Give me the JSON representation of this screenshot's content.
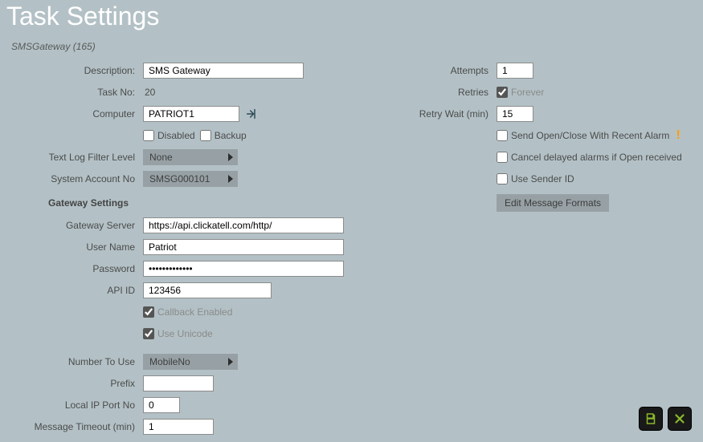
{
  "title": "Task Settings",
  "subtitle": "SMSGateway (165)",
  "left": {
    "description_label": "Description:",
    "description_value": "SMS Gateway",
    "taskno_label": "Task No:",
    "taskno_value": "20",
    "computer_label": "Computer",
    "computer_value": "PATRIOT1",
    "disabled_label": "Disabled",
    "backup_label": "Backup",
    "filter_label": "Text Log Filter Level",
    "filter_value": "None",
    "sysacct_label": "System Account No",
    "sysacct_value": "SMSG000101",
    "gateway_header": "Gateway Settings",
    "gateway_server_label": "Gateway Server",
    "gateway_server_value": "https://api.clickatell.com/http/",
    "username_label": "User Name",
    "username_value": "Patriot",
    "password_label": "Password",
    "password_value": "•••••••••••••",
    "apiid_label": "API ID",
    "apiid_value": "123456",
    "callback_label": "Callback Enabled",
    "unicode_label": "Use Unicode",
    "numbertouse_label": "Number To Use",
    "numbertouse_value": "MobileNo",
    "prefix_label": "Prefix",
    "prefix_value": "",
    "localport_label": "Local IP Port No",
    "localport_value": "0",
    "msgtimeout_label": "Message Timeout (min)",
    "msgtimeout_value": "1"
  },
  "right": {
    "attempts_label": "Attempts",
    "attempts_value": "1",
    "retries_label": "Retries",
    "retries_forever_label": "Forever",
    "retrywait_label": "Retry Wait (min)",
    "retrywait_value": "15",
    "sendopen_label": "Send Open/Close With Recent Alarm",
    "canceldelayed_label": "Cancel delayed alarms if Open received",
    "usesender_label": "Use Sender ID",
    "editformats_label": "Edit Message Formats"
  }
}
